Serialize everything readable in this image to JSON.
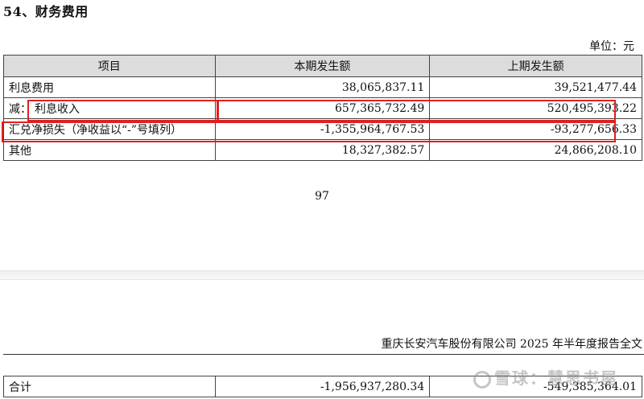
{
  "section_title": "54、财务费用",
  "unit_label": "单位：元",
  "table": {
    "headers": [
      "项目",
      "本期发生额",
      "上期发生额"
    ],
    "rows": [
      {
        "item": "利息费用",
        "current": "38,065,837.11",
        "prior": "39,521,477.44"
      },
      {
        "prefix": "减：",
        "item": "利息收入",
        "current": "657,365,732.49",
        "prior": "520,495,393.22"
      },
      {
        "item": "汇兑净损失（净收益以“-”号填列）",
        "current": "-1,355,964,767.53",
        "prior": "-93,277,656.33"
      },
      {
        "item": "其他",
        "current": "18,327,382.57",
        "prior": "24,866,208.10"
      }
    ]
  },
  "page_number": "97",
  "footer_text": "重庆长安汽车股份有限公司 2025 年半年度报告全文",
  "total_row": {
    "item": "合计",
    "current": "-1,956,937,280.34",
    "prior": "-549,385,364.01"
  },
  "watermark": "雪球：慧思书屋",
  "highlight_color": "#e02020"
}
